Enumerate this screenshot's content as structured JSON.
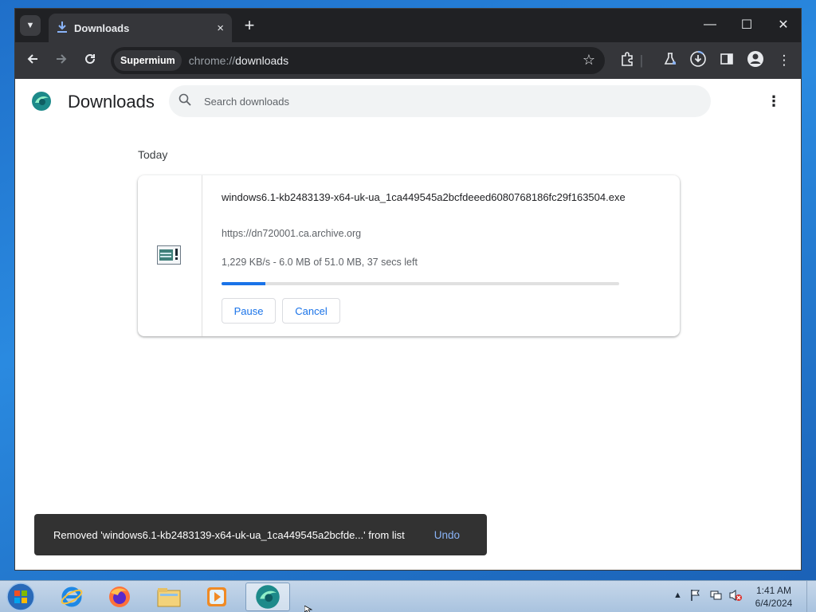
{
  "browser": {
    "tab": {
      "title": "Downloads",
      "close": "×"
    },
    "new_tab": "+",
    "window_controls": {
      "minimize": "—",
      "maximize": "☐",
      "close": "✕"
    },
    "toolbar": {
      "profile_chip": "Supermium",
      "url_scheme": "chrome://",
      "url_host": "downloads"
    }
  },
  "page": {
    "title": "Downloads",
    "search": {
      "placeholder": "Search downloads"
    },
    "section_label": "Today",
    "download": {
      "filename": "windows6.1-kb2483139-x64-uk-ua_1ca449545a2bcfdeeed6080768186fc29f163504.exe",
      "source": "https://dn720001.ca.archive.org",
      "status": "1,229 KB/s - 6.0 MB of 51.0 MB, 37 secs left",
      "progress_fraction": 0.11,
      "pause_label": "Pause",
      "cancel_label": "Cancel"
    },
    "toast": {
      "message": "Removed 'windows6.1-kb2483139-x64-uk-ua_1ca449545a2bcfde...' from list",
      "undo_label": "Undo"
    }
  },
  "taskbar": {
    "apps": [
      "internet-explorer",
      "firefox",
      "file-explorer",
      "media-player",
      "supermium"
    ],
    "clock": {
      "time": "1:41 AM",
      "date": "6/4/2024"
    }
  },
  "colors": {
    "accent": "#1a73e8",
    "toast_bg": "#323232",
    "titlebar": "#202124",
    "toolbar": "#35363a"
  }
}
